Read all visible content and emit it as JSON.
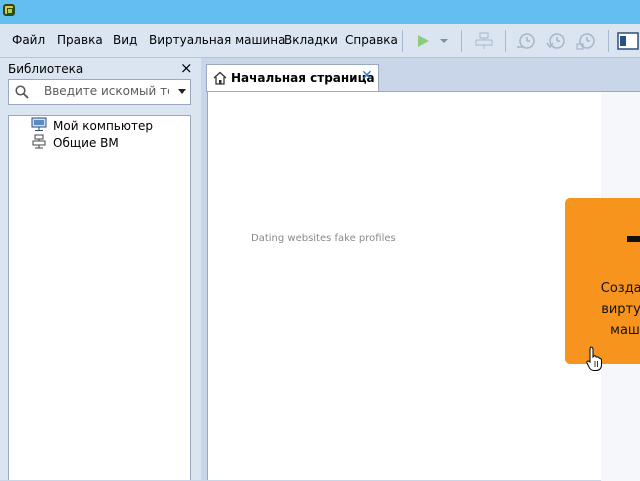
{
  "menubar": {
    "items": [
      "Файл",
      "Правка",
      "Вид",
      "Виртуальная машина",
      "Вкладки",
      "Справка"
    ]
  },
  "toolbar": {
    "icons": [
      "play-icon",
      "play-dropdown-icon",
      "vm-network-icon",
      "snapshot-take-icon",
      "snapshot-revert-icon",
      "snapshot-manager-icon",
      "view-console-icon"
    ]
  },
  "library": {
    "title": "Библиотека",
    "close_glyph": "×",
    "search": {
      "placeholder": "Введите искомый те..."
    },
    "tree": [
      {
        "label": "Мой компьютер",
        "icon": "computer-icon"
      },
      {
        "label": "Общие ВМ",
        "icon": "shared-vms-icon"
      }
    ]
  },
  "tabs": [
    {
      "label": "Начальная страница",
      "icon": "home-icon",
      "close_glyph": "✕",
      "active": true
    }
  ],
  "content": {
    "watermark": "Dating websites fake profiles",
    "create_card": {
      "text_lines": [
        "Создат",
        "виртуа",
        "маш"
      ],
      "color": "#f7941d"
    }
  },
  "colors": {
    "titlebar": "#62bff0",
    "menubar": "#dbe5f2",
    "accent_orange": "#f7941d",
    "tab_close": "#2c77c8"
  }
}
